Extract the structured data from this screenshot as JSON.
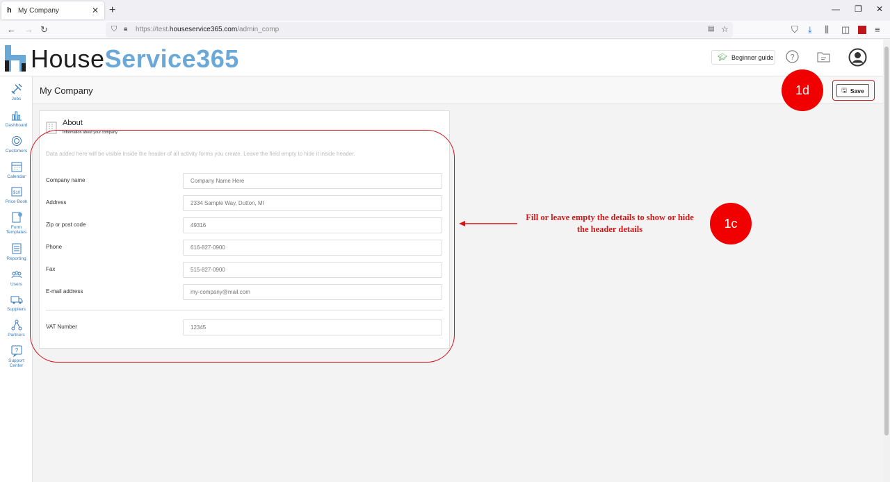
{
  "browser": {
    "tab_title": "My Company",
    "url_prefix": "https://test.",
    "url_domain": "houseservice365.com",
    "url_path": "/admin_comp"
  },
  "header": {
    "logo_part1": "House",
    "logo_part2": "Service365",
    "guide_label": "Beginner guide"
  },
  "sidebar": {
    "items": [
      {
        "label": "Jobs",
        "icon": "tools-icon"
      },
      {
        "label": "Dashboard",
        "icon": "chart-icon"
      },
      {
        "label": "Customers",
        "icon": "customers-icon"
      },
      {
        "label": "Calendar",
        "icon": "calendar-icon"
      },
      {
        "label": "Price Book",
        "icon": "price-book-icon"
      },
      {
        "label": "Form",
        "label2": "Templates",
        "icon": "form-templates-icon"
      },
      {
        "label": "Reporting",
        "icon": "reporting-icon"
      },
      {
        "label": "Users",
        "icon": "users-icon"
      },
      {
        "label": "Suppliers",
        "icon": "truck-icon"
      },
      {
        "label": "Partners",
        "icon": "partners-icon"
      },
      {
        "label": "Support",
        "label2": "Center",
        "icon": "support-icon"
      }
    ]
  },
  "page": {
    "title": "My Company",
    "save_label": "Save"
  },
  "card": {
    "title": "About",
    "subtitle": "Information about your company",
    "note": "Data added here will be visible inside the header of all activity forms you create. Leave the field empty to hide it inside header.",
    "fields": [
      {
        "label": "Company name",
        "placeholder": "Company Name Here"
      },
      {
        "label": "Address",
        "placeholder": "2334 Sample Way, Dutton, MI"
      },
      {
        "label": "Zip or post code",
        "placeholder": "49316"
      },
      {
        "label": "Phone",
        "placeholder": "616-827-0900"
      },
      {
        "label": "Fax",
        "placeholder": "515-827-0900"
      },
      {
        "label": "E-mail address",
        "placeholder": "my-company@mail.com"
      }
    ],
    "vat": {
      "label": "VAT Number",
      "placeholder": "12345"
    }
  },
  "annotations": {
    "badge_save": "1d",
    "badge_form": "1c",
    "callout": "Fill or leave empty the details to  show or hide the header details",
    "accent_color": "#f00000"
  }
}
